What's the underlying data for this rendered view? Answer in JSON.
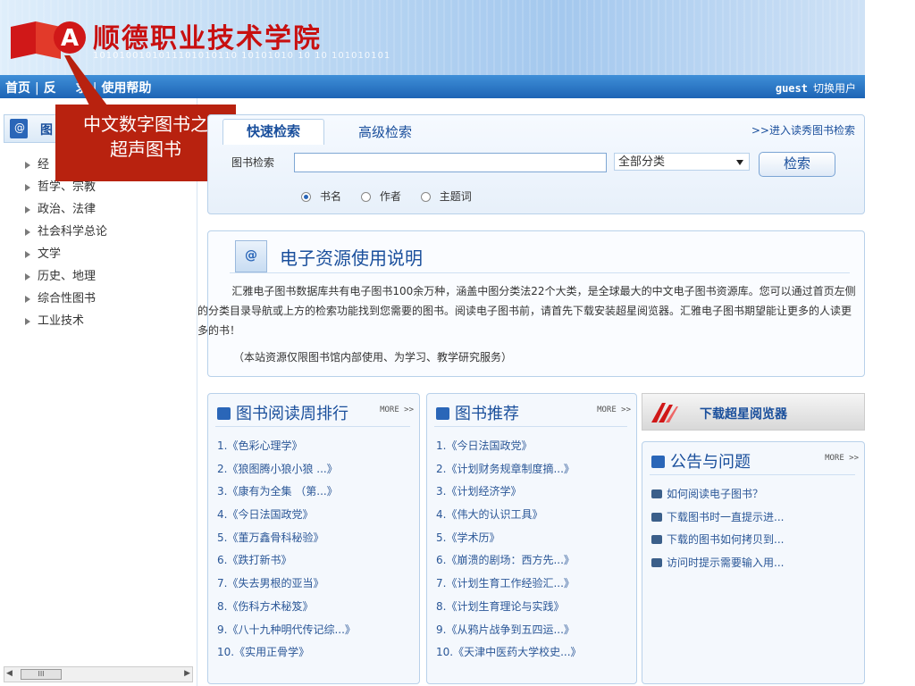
{
  "header": {
    "site_title": "顺德职业技术学院",
    "binary_text": "1010100101011101010110   10101010   10 10 101010101"
  },
  "navbar": {
    "links": [
      "首页",
      "反",
      "求",
      "使用帮助"
    ],
    "user": "guest",
    "switch_user": "切换用户"
  },
  "sidebar": {
    "heading": "图",
    "categories": [
      "经",
      "哲学、宗教",
      "政治、法律",
      "社会科学总论",
      "文学",
      "历史、地理",
      "综合性图书",
      "工业技术"
    ],
    "scroll_thumb": "III"
  },
  "callout": {
    "line1": "中文数字图书之",
    "line2": "超声图书"
  },
  "search": {
    "tab_quick": "快速检索",
    "tab_advanced": "高级检索",
    "reader_link": ">>进入读秀图书检索",
    "label": "图书检索",
    "input_value": "",
    "category_selected": "全部分类",
    "button": "检索",
    "options": [
      "书名",
      "作者",
      "主题词"
    ],
    "selected_option": "书名"
  },
  "info": {
    "title": "电子资源使用说明",
    "body": "汇雅电子图书数据库共有电子图书100余万种，涵盖中图分类法22个大类，是全球最大的中文电子图书资源库。您可以通过首页左侧的分类目录导航或上方的检索功能找到您需要的图书。阅读电子图书前，请首先下载安装超星阅览器。汇雅电子图书期望能让更多的人读更多的书！",
    "note": "（本站资源仅限图书馆内部使用、为学习、教学研究服务）"
  },
  "weekly_rank": {
    "title": "图书阅读周排行",
    "more": "MORE >>",
    "items": [
      "1.《色彩心理学》",
      "2.《狼图腾小狼小狼 ...》",
      "3.《康有为全集 （第...》",
      "4.《今日法国政党》",
      "5.《董万鑫骨科秘验》",
      "6.《跌打新书》",
      "7.《失去男根的亚当》",
      "8.《伤科方术秘笈》",
      "9.《八十九种明代传记综...》",
      "10.《实用正骨学》"
    ]
  },
  "recommend": {
    "title": "图书推荐",
    "more": "MORE >>",
    "items": [
      "1.《今日法国政党》",
      "2.《计划财务规章制度摘...》",
      "3.《计划经济学》",
      "4.《伟大的认识工具》",
      "5.《学术历》",
      "6.《崩溃的剧场：西方先...》",
      "7.《计划生育工作经验汇...》",
      "8.《计划生育理论与实践》",
      "9.《从鸦片战争到五四运...》",
      "10.《天津中医药大学校史...》"
    ]
  },
  "download": {
    "label": "下载超星阅览器"
  },
  "notices": {
    "title": "公告与问题",
    "more": "MORE >>",
    "items": [
      "如何阅读电子图书？",
      "下载图书时一直提示进...",
      "下载的图书如何拷贝到...",
      "访问时提示需要输入用..."
    ]
  },
  "colors": {
    "title_red": "#c81010",
    "nav_blue": "#1d64b5",
    "link_blue": "#1a4f9c",
    "callout_red": "#b8220f"
  }
}
